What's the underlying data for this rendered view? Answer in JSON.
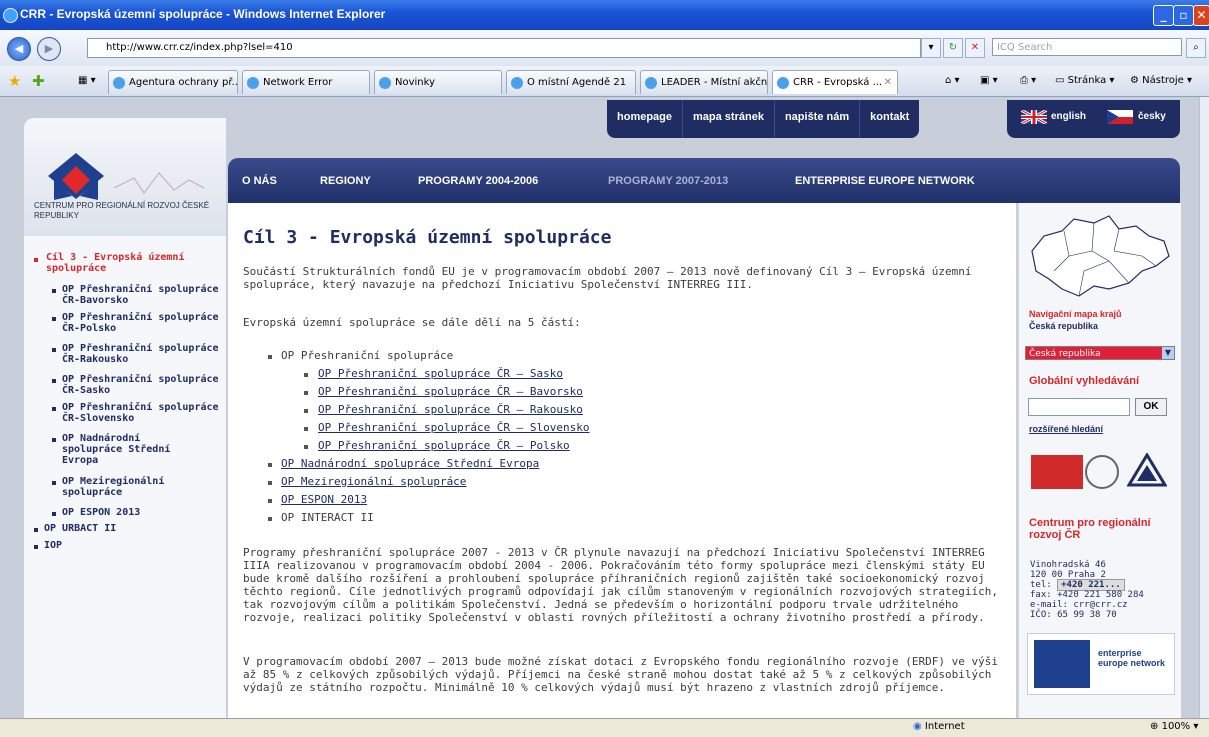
{
  "window": {
    "title": "CRR - Evropská územní spolupráce - Windows Internet Explorer"
  },
  "addressbar": {
    "url": "http://www.crr.cz/index.php?lsel=410",
    "search_placeholder": "ICQ Search"
  },
  "tabs": [
    {
      "label": "Agentura ochrany př..."
    },
    {
      "label": "Network Error"
    },
    {
      "label": "Novinky"
    },
    {
      "label": "O místní Agendě 21"
    },
    {
      "label": "LEADER - Místní akčn..."
    },
    {
      "label": "CRR - Evropská ..."
    }
  ],
  "toolbar": {
    "page_label": "Stránka",
    "tools_label": "Nástroje"
  },
  "site": {
    "logo_text": "CENTRUM PRO REGIONÁLNÍ ROZVOJ ČESKÉ REPUBLIKY",
    "topnav": [
      "homepage",
      "mapa stránek",
      "napište nám",
      "kontakt"
    ],
    "lang": {
      "en": "english",
      "cz": "česky"
    },
    "mainnav": [
      {
        "label": "O NÁS"
      },
      {
        "label": "REGIONY"
      },
      {
        "label": "PROGRAMY 2004-2006"
      },
      {
        "label": "PROGRAMY 2007-2013"
      },
      {
        "label": "ENTERPRISE EUROPE NETWORK"
      }
    ]
  },
  "leftmenu": {
    "active": "Cíl 3 - Evropská územní spolupráce",
    "items": [
      "OP Přeshraniční spolupráce ČR-Bavorsko",
      "OP Přeshraniční spolupráce ČR-Polsko",
      "OP Přeshraniční spolupráce ČR-Rakousko",
      "OP Přeshraniční spolupráce ČR-Sasko",
      "OP Přeshraniční spolupráce ČR-Slovensko",
      "OP Nadnárodní spolupráce Střední Evropa",
      "OP Meziregionální spolupráce",
      "OP ESPON 2013"
    ],
    "top_items": [
      "OP URBACT II",
      "IOP"
    ]
  },
  "content": {
    "heading": "Cíl 3 - Evropská územní spolupráce",
    "intro": "Součástí Strukturálních fondů EU je v programovacím období 2007 – 2013 nově definovaný Cíl 3 – Evropská územní spolupráce, který navazuje na předchozí Iniciativu Společenství INTERREG III.",
    "parts_intro": "Evropská územní spolupráce se dále dělí na 5 částí:",
    "list_top": "OP Přeshraniční spolupráce",
    "list_sub": [
      "OP Přeshraniční spolupráce ČR – Sasko",
      "OP Přeshraniční spolupráce ČR – Bavorsko",
      "OP Přeshraniční spolupráce ČR – Rakousko",
      "OP Přeshraniční spolupráce ČR – Slovensko",
      "OP Přeshraniční spolupráce ČR – Polsko"
    ],
    "list_rest": [
      "OP Nadnárodní spolupráce Střední Evropa",
      "OP Meziregionální spolupráce",
      "OP ESPON 2013",
      "OP INTERACT II"
    ],
    "para1": "Programy přeshraniční spolupráce 2007 - 2013 v ČR plynule navazují na předchozí Iniciativu Společenství INTERREG IIIA realizovanou v programovacím období 2004 - 2006. Pokračováním této formy spolupráce mezi členskými státy EU bude kromě dalšího rozšíření a prohloubení spolupráce příhraničních regionů zajištěn také socioekonomický rozvoj těchto regionů. Cíle jednotlivých programů odpovídají jak cílům stanoveným v regionálních rozvojových strategiích, tak rozvojovým cílům a politikám Společenství. Jedná se především o horizontální podporu trvale udržitelného rozvoje, realizaci politiky Společenství v oblasti rovných příležitostí a ochrany životního prostředí a přírody.",
    "para2": "V programovacím období 2007 – 2013 bude možné získat dotaci z Evropského fondu regionálního rozvoje (ERDF) ve výši až 85 % z celkových způsobilých výdajů. Příjemci na české straně mohou dostat také až 5 % z celkových způsobilých výdajů ze státního rozpočtu. Minimálně 10 % celkových výdajů musí být hrazeno z vlastních zdrojů příjemce."
  },
  "right": {
    "map_title": "Navigační mapa krajů",
    "map_sub": "Česká republika",
    "select_value": "Česká republika",
    "search_title": "Globální vyhledávání",
    "ok_label": "OK",
    "advanced": "rozšířené hledání",
    "crr_title": "Centrum pro regionální rozvoj ČR",
    "address_lines": [
      "Vinohradská 46",
      "120 00 Praha 2",
      "tel:",
      "fax: +420 221 580 284",
      "e-mail: crr@crr.cz",
      "IČO: 65 99 38 70"
    ],
    "phone": "+420 221...",
    "een": "enterprise europe network"
  },
  "status": {
    "zone": "Internet",
    "zoom": "100%"
  }
}
